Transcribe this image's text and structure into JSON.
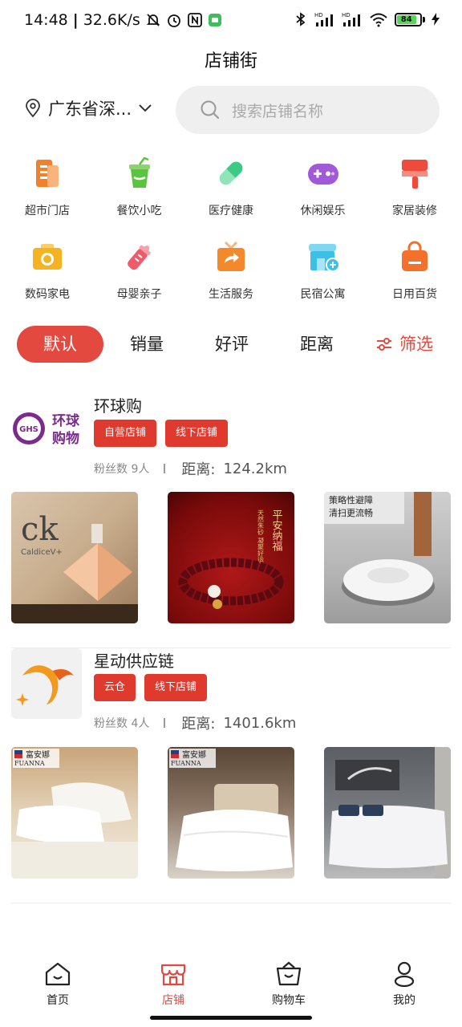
{
  "status_bar": {
    "time": "14:48",
    "net_speed": "32.6K/s",
    "battery": "84"
  },
  "header": {
    "title": "店铺街"
  },
  "location": {
    "text": "广东省深...",
    "icon": "location-pin-icon"
  },
  "search": {
    "placeholder": "搜索店铺名称",
    "icon": "search-icon"
  },
  "categories": [
    {
      "label": "超市门店",
      "icon": "supermarket-icon",
      "color": "#f4802b"
    },
    {
      "label": "餐饮小吃",
      "icon": "drink-cup-icon",
      "color": "#5ac43e"
    },
    {
      "label": "医疗健康",
      "icon": "pill-icon",
      "color": "#4ad18d"
    },
    {
      "label": "休闲娱乐",
      "icon": "gamepad-icon",
      "color": "#a259d9"
    },
    {
      "label": "家居装修",
      "icon": "paint-roller-icon",
      "color": "#ef4a3c"
    },
    {
      "label": "数码家电",
      "icon": "camera-icon",
      "color": "#f6b321"
    },
    {
      "label": "母婴亲子",
      "icon": "baby-bottle-icon",
      "color": "#f25a6a"
    },
    {
      "label": "生活服务",
      "icon": "service-box-icon",
      "color": "#f4892b"
    },
    {
      "label": "民宿公寓",
      "icon": "homestay-icon",
      "color": "#3cc0e8"
    },
    {
      "label": "日用百货",
      "icon": "shopping-bag-icon",
      "color": "#f4702b"
    }
  ],
  "sort": {
    "default": "默认",
    "sales": "销量",
    "rating": "好评",
    "distance": "距离",
    "filter": "筛选"
  },
  "shops": [
    {
      "name": "环球购",
      "logo_text_1": "环球",
      "logo_text_2": "购物",
      "logo_badge": "GHS",
      "tags": [
        "自营店铺",
        "线下店铺"
      ],
      "fans": "粉丝数 9人",
      "distance_label": "距离:",
      "distance": "124.2km",
      "products": [
        {
          "caption_1": "ck",
          "caption_2": "CaldiceV+"
        },
        {
          "caption_1": "平安纳福",
          "caption_2": "天然朱砂 凝聚好运"
        },
        {
          "caption_1": "策略性避障",
          "caption_2": "清扫更流畅"
        }
      ]
    },
    {
      "name": "星动供应链",
      "tags": [
        "云仓",
        "线下店铺"
      ],
      "fans": "粉丝数 4人",
      "distance_label": "距离:",
      "distance": "1401.6km",
      "products": [
        {
          "brand": "富安娜",
          "brand_en": "FUANNA"
        },
        {
          "brand": "富安娜",
          "brand_en": "FUANNA"
        },
        {
          "brand": "",
          "brand_en": ""
        }
      ]
    }
  ],
  "tabbar": [
    {
      "label": "首页",
      "icon": "home-icon"
    },
    {
      "label": "店铺",
      "icon": "store-icon",
      "active": true
    },
    {
      "label": "购物车",
      "icon": "cart-icon"
    },
    {
      "label": "我的",
      "icon": "profile-icon"
    }
  ],
  "colors": {
    "accent": "#e4493f",
    "tag": "#e03a2e"
  }
}
